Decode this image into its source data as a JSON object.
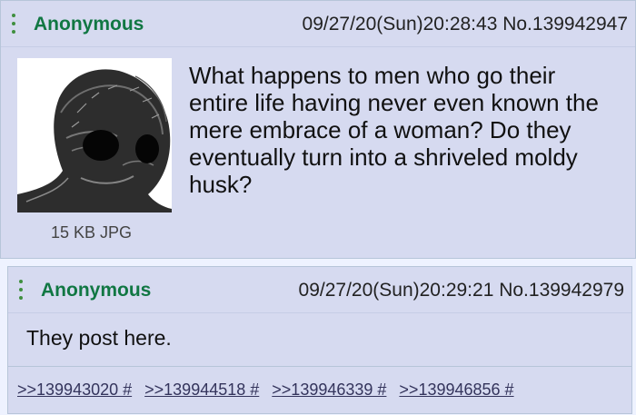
{
  "posts": [
    {
      "name": "Anonymous",
      "meta": "09/27/20(Sun)20:28:43 No.139942947",
      "file_info": "15 KB JPG",
      "body": "What happens to men who go their entire life having never even known the mere embrace of a woman? Do they eventually turn into a shriveled moldy husk?",
      "thumbnail_icon": "wojak-husk-image"
    },
    {
      "name": "Anonymous",
      "meta": "09/27/20(Sun)20:29:21 No.139942979",
      "body": "They post here.",
      "backlinks": [
        ">>139943020 #",
        ">>139944518 #",
        ">>139946339 #",
        ">>139946856 #"
      ]
    }
  ],
  "colors": {
    "post_bg": "#d6daf0",
    "name": "#117743",
    "link": "#34345c",
    "border": "#b7c5d9"
  }
}
